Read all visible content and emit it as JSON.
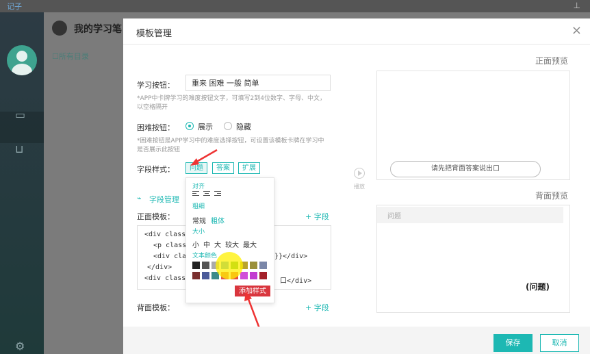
{
  "app": {
    "logo_text": "记子",
    "header_title": "我的学习笔",
    "all_label": "☐所有目录"
  },
  "modal": {
    "title": "模板管理",
    "close_glyph": "×"
  },
  "form": {
    "study_label": "学习按钮：",
    "study_value": "重来 困难 一般 简单",
    "study_hint": "*APP中卡牌学习的难度按钮文字，可填写2到4位数字、字母、中文，以空格隔开",
    "hard_label": "困难按钮：",
    "hard_option_show": "展示",
    "hard_option_hide": "隐藏",
    "hard_hint": "*困难按钮是APP学习中的难度选择按钮，可设置该模板卡牌在学习中是否展示此按钮",
    "field_style_label": "字段样式：",
    "field_buttons": [
      "问题",
      "答案",
      "扩展"
    ],
    "field_manage": "字段管理",
    "front_template_label": "正面模板：",
    "back_template_label": "背面模板：",
    "add_field": "+ 字段",
    "code_lines": [
      "<div class=\"",
      "<p class=",
      "<div class",
      "</div>",
      "<div class=\""
    ],
    "code_fragment_1": "}}</div>",
    "code_fragment_2": "口</div>"
  },
  "style_popup": {
    "align_label": "对齐",
    "weight_label": "粗细",
    "weight_options": [
      "常规",
      "粗体"
    ],
    "size_label": "大小",
    "size_options": [
      "小",
      "中",
      "大",
      "较大",
      "最大"
    ],
    "color_label": "文本颜色",
    "colors_row1": [
      "#222222",
      "#555555",
      "#aaaaaa",
      "#4aa3df",
      "#52b043",
      "#b9a32c",
      "#9a8f3a",
      "#7a86a8"
    ],
    "colors_row2": [
      "#7a2f2f",
      "#4b5b9a",
      "#3c8b8b",
      "#e2584a",
      "#e64d3d",
      "#d04fd9",
      "#c23bd1",
      "#a3202a"
    ],
    "tooltip": "添加样式"
  },
  "preview": {
    "front_label": "正面预览",
    "back_label": "背面预览",
    "reveal_button": "请先把背面答案说出口",
    "play_label": "播放",
    "question_placeholder": "问题",
    "question_bold": "(问题)"
  },
  "footer": {
    "save": "保存",
    "cancel": "取消"
  }
}
